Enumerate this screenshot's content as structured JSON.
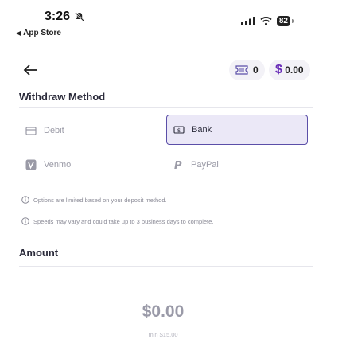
{
  "status_bar": {
    "time": "3:26",
    "back_app": "App Store",
    "battery": "82"
  },
  "header": {
    "tickets": "0",
    "cash": "$ 0.00"
  },
  "withdraw": {
    "title": "Withdraw Method",
    "methods": [
      {
        "label": "Debit",
        "icon": "card-icon",
        "selected": false
      },
      {
        "label": "Bank",
        "icon": "bank-icon",
        "selected": true
      },
      {
        "label": "Venmo",
        "icon": "venmo-icon",
        "selected": false
      },
      {
        "label": "PayPal",
        "icon": "paypal-icon",
        "selected": false
      }
    ],
    "notes": [
      "Options are limited based on your deposit method.",
      "Speeds may vary and could take up to 3 business days to complete."
    ]
  },
  "amount": {
    "title": "Amount",
    "value": "$0.00",
    "min": "min $15.00"
  },
  "colors": {
    "accent": "#5b4fa8",
    "selected_bg": "#ebe8f7",
    "brand_purple": "#6a2fb8"
  }
}
